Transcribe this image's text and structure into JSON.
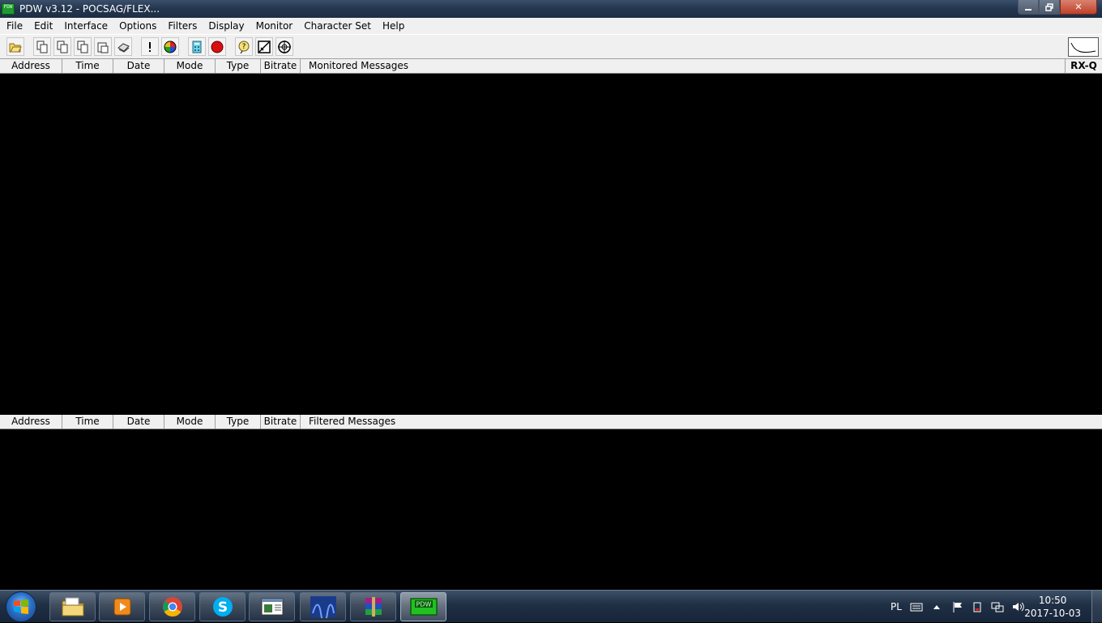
{
  "window": {
    "title": "PDW v3.12 - POCSAG/FLEX...",
    "app_icon": "PDW",
    "controls": {
      "minimize": "minimize-icon",
      "maximize": "restore-icon",
      "close": "✕"
    }
  },
  "menu": [
    "File",
    "Edit",
    "Interface",
    "Options",
    "Filters",
    "Display",
    "Monitor",
    "Character Set",
    "Help"
  ],
  "toolbar": {
    "icons": [
      "open-folder-icon",
      "copy-icon",
      "copy-icon",
      "copy-icon",
      "paste-icon",
      "print-icon",
      "alert-icon",
      "color-wheel-icon",
      "calculator-icon",
      "record-icon",
      "help-icon",
      "graph-icon",
      "target-icon"
    ]
  },
  "monitored_header": {
    "address": "Address",
    "time": "Time",
    "date": "Date",
    "mode": "Mode",
    "type": "Type",
    "bitrate": "Bitrate",
    "messages": "Monitored Messages",
    "rxq": "RX-Q"
  },
  "filtered_header": {
    "address": "Address",
    "time": "Time",
    "date": "Date",
    "mode": "Mode",
    "type": "Type",
    "bitrate": "Bitrate",
    "messages": "Filtered Messages"
  },
  "taskbar": {
    "apps": [
      "file-explorer",
      "media-player",
      "chrome",
      "skype",
      "notepad-window",
      "app-blue",
      "winrar",
      "pdw"
    ],
    "pdw_label": "PDW",
    "language": "PL",
    "clock_time": "10:50",
    "clock_date": "2017-10-03"
  },
  "colors": {
    "pane_bg": "#000000",
    "chrome_bg": "#f0f0f0",
    "pdw_green": "#1e9b2e"
  }
}
